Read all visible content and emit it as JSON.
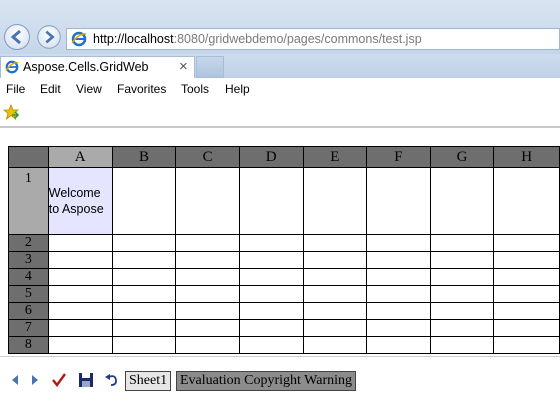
{
  "browser": {
    "url_host": "http://localhost",
    "url_rest": ":8080/gridwebdemo/pages/commons/test.jsp",
    "tab_title": "Aspose.Cells.GridWeb",
    "tab_close": "×",
    "icons": [
      "back-arrow-icon",
      "forward-arrow-icon",
      "ie-logo-icon",
      "favorites-star-icon"
    ]
  },
  "menu": [
    "File",
    "Edit",
    "View",
    "Favorites",
    "Tools",
    "Help"
  ],
  "grid": {
    "columns": [
      "A",
      "B",
      "C",
      "D",
      "E",
      "F",
      "G",
      "H"
    ],
    "rows": [
      "1",
      "2",
      "3",
      "4",
      "5",
      "6",
      "7",
      "8"
    ],
    "cells": {
      "A1": "Welcome to Aspose"
    },
    "active_cell": "A1"
  },
  "sheetbar": {
    "sheet_tabs": [
      "Sheet1"
    ],
    "warning_tab": "Evaluation Copyright Warning",
    "tools": [
      "prev-sheet-icon",
      "next-sheet-icon",
      "submit-check-icon",
      "save-icon",
      "undo-icon"
    ]
  },
  "colors": {
    "header_bg": "#6e6e6e",
    "selected_header_bg": "#aaaaaa",
    "active_cell_bg": "#e5e5ff",
    "warning_tab_bg": "#8c8c8c"
  }
}
